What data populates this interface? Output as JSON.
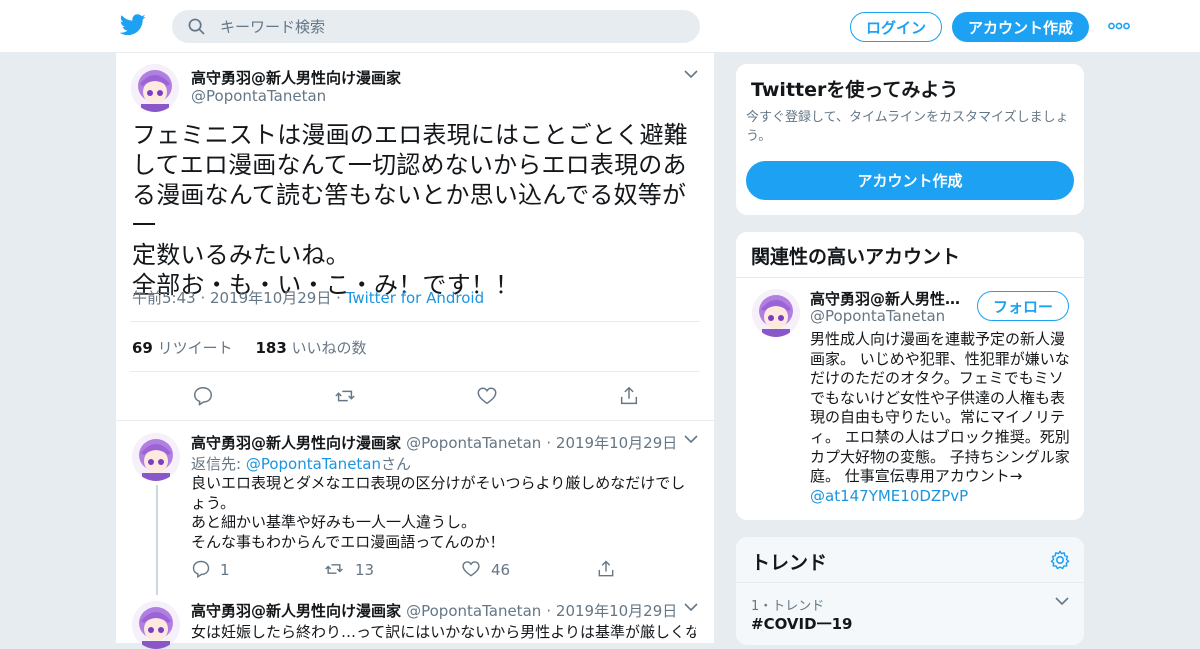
{
  "header": {
    "search_placeholder": "キーワード検索",
    "login_label": "ログイン",
    "signup_label": "アカウント作成"
  },
  "tweet": {
    "author_name": "高守勇羽@新人男性向け漫画家",
    "author_handle": "@PopontaTanetan",
    "text": "フェミニストは漫画のエロ表現にはことごとく避難\nしてエロ漫画なんて一切認めないからエロ表現のあ\nる漫画なんて読む筈もないとか思い込んでる奴等が一\n定数いるみたいね。\n全部お・も・い・こ・み！です！！",
    "time": "午前5:43 · 2019年10月29日",
    "sep": " · ",
    "source": "Twitter for Android",
    "retweets": "69",
    "retweets_label": "リツイート",
    "likes": "183",
    "likes_label": "いいねの数"
  },
  "replies": [
    {
      "author_name": "高守勇羽@新人男性向け漫画家",
      "author_handle": "@PopontaTanetan",
      "date": "· 2019年10月29日",
      "reply_prefix": "返信先:",
      "reply_to": "@PopontaTanetan",
      "reply_suffix": "さん",
      "text": "良いエロ表現とダメなエロ表現の区分けがそいつらより厳しめなだけでし\nょう。\nあと細かい基準や好みも一人一人違うし。\nそんな事もわからんでエロ漫画語ってんのか！",
      "reply_count": "1",
      "retweet_count": "13",
      "like_count": "46"
    },
    {
      "author_name": "高守勇羽@新人男性向け漫画家",
      "author_handle": "@PopontaTanetan",
      "date": "· 2019年10月29日",
      "text": "女は妊娠したら終わり…って訳にはいかないから男性よりは基準が厳しくな"
    }
  ],
  "sidebar": {
    "signup_card": {
      "title": "Twitterを使ってみよう",
      "desc": "今すぐ登録して、タイムラインをカスタマイズしましょ\nう。",
      "button": "アカウント作成"
    },
    "related": {
      "title": "関連性の高いアカウント",
      "name": "高守勇羽@新人男性…",
      "handle": "@PopontaTanetan",
      "follow_label": "フォロー",
      "bio": "男性成人向け漫画を連載予定の新人漫\n画家。 いじめや犯罪、性犯罪が嫌いな\nだけのただのオタク。フェミでもミソ\nでもないけど女性や子供達の人権も表\n現の自由も守りたい。常にマイノリテ\nィ。 エロ禁の人はブロック推奨。死別\nカプ大好物の変態。 子持ちシングル家\n庭。 仕事宣伝専用アカウント→",
      "bio_link": "@at147YME10DZPvP"
    },
    "trends": {
      "title": "トレンド",
      "item_rank": "1・トレンド",
      "item_name": "#COVID一19"
    }
  },
  "colors": {
    "accent": "#1da1f2",
    "link": "#1b95e0",
    "muted": "#657786",
    "background": "#e6ecf0"
  },
  "icons": [
    "twitter-bird-icon",
    "search-icon",
    "more-icon",
    "chevron-down-icon",
    "reply-icon",
    "retweet-icon",
    "like-icon",
    "share-icon",
    "settings-icon"
  ]
}
